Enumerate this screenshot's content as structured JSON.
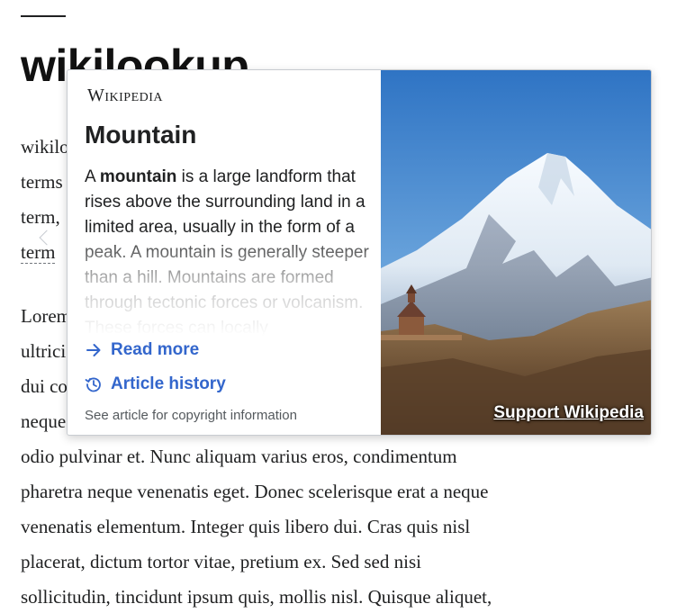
{
  "page": {
    "site_title": "wikilookup",
    "intro_lines": [
      "wikilo",
      "terms",
      "term,",
      "term"
    ],
    "body_lines": [
      "Lorem",
      "ultrici",
      "dui co",
      "neque",
      "odio pulvinar et. Nunc aliquam varius eros, condimentum",
      "pharetra neque venenatis eget. Donec scelerisque erat a neque",
      "venenatis elementum. Integer quis libero dui. Cras quis nisl",
      "placerat, dictum tortor vitae, pretium ex. Sed sed nisi",
      "sollicitudin, tincidunt ipsum quis, mollis nisl. Quisque aliquet,"
    ]
  },
  "popup": {
    "wordmark": "Wikipedia",
    "title": "Mountain",
    "extract_prefix": "A ",
    "extract_bold": "mountain",
    "extract_rest": " is a large landform that rises above the surrounding land in a limited area, usually in the form of a peak. A mountain is generally steeper than a hill. Mountains are formed through tectonic forces or volcanism. These forces can locally",
    "read_more": "Read more",
    "read_more_icon": "arrow-right-icon",
    "article_history": "Article history",
    "article_history_icon": "history-icon",
    "copyright": "See article for copyright information",
    "support": "Support Wikipedia",
    "accent_color": "#3366cc"
  }
}
